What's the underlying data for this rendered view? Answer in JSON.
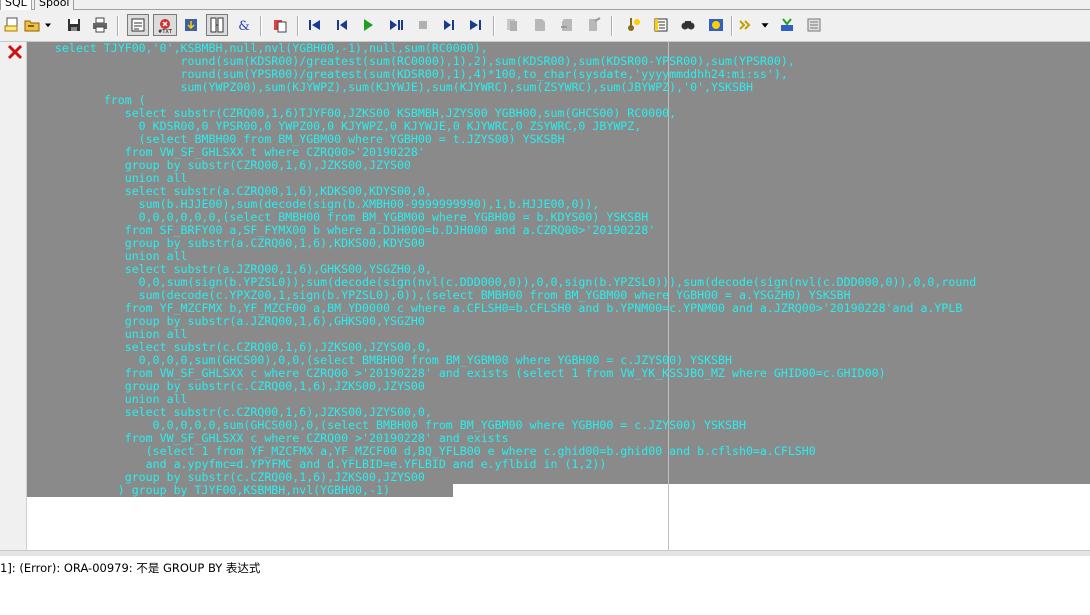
{
  "tabs": [
    {
      "label": "SQL",
      "active": true
    },
    {
      "label": "Spool",
      "active": false
    }
  ],
  "toolbar": {
    "icons": [
      "new-sql-icon",
      "open-icon",
      "save-icon",
      "print-icon",
      "toggle-output-icon",
      "clear-marked-icon",
      "load-icon",
      "query-builder-icon",
      "beautifier-icon",
      "copy-icon",
      "first-record-icon",
      "previous-record-icon",
      "execute-icon",
      "step-icon",
      "stop-icon",
      "next-record-icon",
      "last-record-icon",
      "cut-icon",
      "paste-icon",
      "undo-icon",
      "redo-icon",
      "debug-icon",
      "explain-plan-icon",
      "find-icon",
      "commit-icon",
      "rollback-icon",
      "dropdown-arrow-icon",
      "help-icon",
      "properties-icon"
    ]
  },
  "editor": {
    "error_marker": "error-x-icon",
    "code": "    select TJYF00,'0',KSBMBH,null,nvl(YGBH00,-1),null,sum(RC0000),\n                      round(sum(KDSR00)/greatest(sum(RC0000),1),2),sum(KDSR00),sum(KDSR00-YPSR00),sum(YPSR00),\n                      round(sum(YPSR00)/greatest(sum(KDSR00),1),4)*100,to_char(sysdate,'yyyymmddhh24:mi:ss'),\n                      sum(YWPZ00),sum(KJYWPZ),sum(KJYWJE),sum(KJYWRC),sum(ZSYWRC),sum(JBYWPZ),'0',YSKSBH\n           from (\n              select substr(CZRQ00,1,6)TJYF00,JZKS00 KSBMBH,JZYS00 YGBH00,sum(GHCS00) RC0000,\n                0 KDSR00,0 YPSR00,0 YWPZ00,0 KJYWPZ,0 KJYWJE,0 KJYWRC,0 ZSYWRC,0 JBYWPZ,\n                (select BMBH00 from BM_YGBM00 where YGBH00 = t.JZYS00) YSKSBH\n              from VW_SF_GHLSXX t where CZRQ00>'20190228'\n              group by substr(CZRQ00,1,6),JZKS00,JZYS00\n              union all\n              select substr(a.CZRQ00,1,6),KDKS00,KDYS00,0,\n                sum(b.HJJE00),sum(decode(sign(b.XMBH00-9999999990),1,b.HJJE00,0)),\n                0,0,0,0,0,0,(select BMBH00 from BM_YGBM00 where YGBH00 = b.KDYS00) YSKSBH\n              from SF_BRFY00 a,SF_FYMX00 b where a.DJH000=b.DJH000 and a.CZRQ00>'20190228'\n              group by substr(a.CZRQ00,1,6),KDKS00,KDYS00\n              union all\n              select substr(a.JZRQ00,1,6),GHKS00,YSGZH0,0,\n                0,0,sum(sign(b.YPZSL0)),sum(decode(sign(nvl(c.DDD000,0)),0,0,sign(b.YPZSL0))),sum(decode(sign(nvl(c.DDD000,0)),0,0,round\n                sum(decode(c.YPXZ00,1,sign(b.YPZSL0),0)),(select BMBH00 from BM_YGBM00 where YGBH00 = a.YSGZH0) YSKSBH\n              from YF_MZCFMX b,YF_MZCF00 a,BM_YD0000 c where a.CFLSH0=b.CFLSH0 and b.YPNM00=c.YPNM00 and a.JZRQ00>'20190228'and a.YPLB\n              group by substr(a.JZRQ00,1,6),GHKS00,YSGZH0\n              union all\n              select substr(c.CZRQ00,1,6),JZKS00,JZYS00,0,\n                0,0,0,0,sum(GHCS00),0,0,(select BMBH00 from BM_YGBM00 where YGBH00 = c.JZYS00) YSKSBH\n              from VW_SF_GHLSXX c where CZRQ00 >'20190228' and exists (select 1 from VW_YK_KSSJBO_MZ where GHID00=c.GHID00)\n              group by substr(c.CZRQ00,1,6),JZKS00,JZYS00\n              union all\n              select substr(c.CZRQ00,1,6),JZKS00,JZYS00,0,\n                  0,0,0,0,0,sum(GHCS00),0,(select BMBH00 from BM_YGBM00 where YGBH00 = c.JZYS00) YSKSBH\n              from VW_SF_GHLSXX c where CZRQ00 >'20190228' and exists\n                 (select 1 from YF_MZCFMX a,YF_MZCF00 d,BQ_YFLB00 e where c.ghid00=b.ghid00 and b.cflsh0=a.CFLSH0\n                 and a.ypyfmc=d.YPYFMC and d.YFLBID=e.YFLBID and e.yflbid in (1,2))\n              group by substr(c.CZRQ00,1,6),JZKS00,JZYS00\n             ) group by TJYF00,KSBMBH,nvl(YGBH00,-1)"
  },
  "status": {
    "message": "1]: (Error): ORA-00979: 不是 GROUP BY 表达式"
  }
}
